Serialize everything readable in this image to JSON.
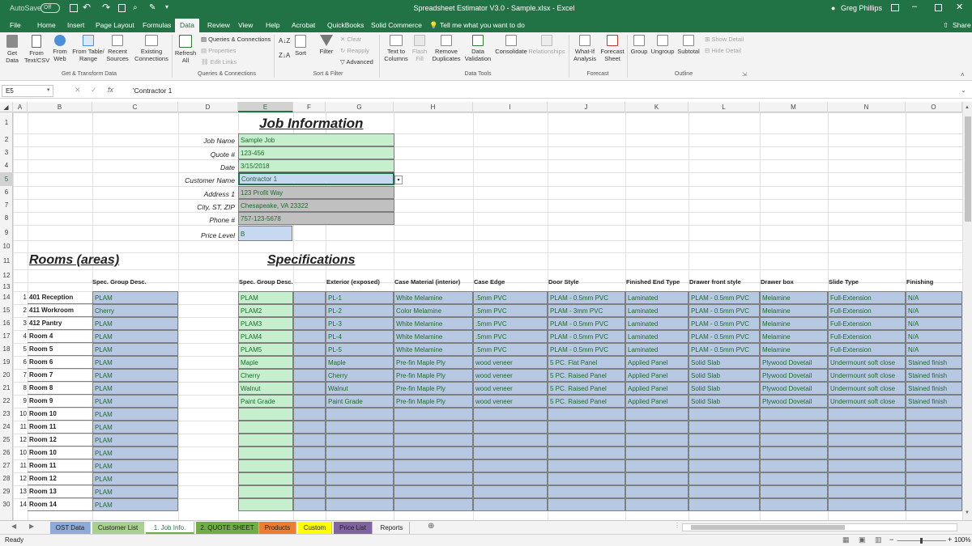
{
  "titlebar": {
    "autosave_label": "AutoSave",
    "autosave_state": "Off",
    "title": "Spreadsheet Estimator V3.0 - Sample.xlsx  -  Excel",
    "user": "Greg Phillips"
  },
  "menu": {
    "tabs": [
      "File",
      "Home",
      "Insert",
      "Page Layout",
      "Formulas",
      "Data",
      "Review",
      "View",
      "Help",
      "Acrobat",
      "QuickBooks",
      "Solid Commerce"
    ],
    "active": "Data",
    "tell_me": "Tell me what you want to do",
    "share": "Share"
  },
  "ribbon": {
    "get_data": "Get\nData",
    "from_text": "From\nText/CSV",
    "from_web": "From\nWeb",
    "from_table": "From Table/\nRange",
    "recent_sources": "Recent\nSources",
    "existing_connections": "Existing\nConnections",
    "group1": "Get & Transform Data",
    "refresh_all": "Refresh\nAll",
    "queries_connections": "Queries & Connections",
    "properties": "Properties",
    "edit_links": "Edit Links",
    "group2": "Queries & Connections",
    "sort": "Sort",
    "filter": "Filter",
    "clear": "Clear",
    "reapply": "Reapply",
    "advanced": "Advanced",
    "group3": "Sort & Filter",
    "text_to_columns": "Text to\nColumns",
    "flash_fill": "Flash\nFill",
    "remove_duplicates": "Remove\nDuplicates",
    "data_validation": "Data\nValidation",
    "consolidate": "Consolidate",
    "relationships": "Relationships",
    "group4": "Data Tools",
    "what_if": "What-If\nAnalysis",
    "forecast_sheet": "Forecast\nSheet",
    "group5": "Forecast",
    "group_btn": "Group",
    "ungroup": "Ungroup",
    "subtotal": "Subtotal",
    "show_detail": "Show Detail",
    "hide_detail": "Hide Detail",
    "group6": "Outline"
  },
  "formula_bar": {
    "name_box": "E5",
    "fx": "fx",
    "content": "'Contractor 1"
  },
  "columns": [
    "A",
    "B",
    "C",
    "D",
    "E",
    "F",
    "G",
    "H",
    "I",
    "J",
    "K",
    "L",
    "M",
    "N",
    "O"
  ],
  "rows": [
    "1",
    "2",
    "3",
    "4",
    "5",
    "6",
    "7",
    "8",
    "9",
    "10",
    "11",
    "12",
    "13",
    "14",
    "15",
    "16",
    "17",
    "18",
    "19",
    "20",
    "21",
    "22",
    "23",
    "24",
    "25",
    "26",
    "27",
    "28",
    "29",
    "30"
  ],
  "job_info": {
    "title": "Job Information",
    "labels": [
      "Job Name",
      "Quote #",
      "Date",
      "Customer Name",
      "Address 1",
      "City, ST, ZIP",
      "Phone #",
      "Price Level"
    ],
    "values": [
      "Sample Job",
      "123-456",
      "3/15/2018",
      "Contractor 1",
      "123 Profit Way",
      "Chesapeake, VA 23322",
      "757-123-5678",
      "B"
    ]
  },
  "rooms": {
    "title": "Rooms (areas)",
    "header": "Spec. Group Desc.",
    "list": [
      {
        "n": "1",
        "name": "401 Reception",
        "spec": "PLAM"
      },
      {
        "n": "2",
        "name": "411 Workroom",
        "spec": "Cherry"
      },
      {
        "n": "3",
        "name": "412 Pantry",
        "spec": "PLAM"
      },
      {
        "n": "4",
        "name": "Room 4",
        "spec": "PLAM"
      },
      {
        "n": "5",
        "name": "Room 5",
        "spec": "PLAM"
      },
      {
        "n": "6",
        "name": "Room 6",
        "spec": "PLAM"
      },
      {
        "n": "7",
        "name": "Room 7",
        "spec": "PLAM"
      },
      {
        "n": "8",
        "name": "Room 8",
        "spec": "PLAM"
      },
      {
        "n": "9",
        "name": "Room 9",
        "spec": "PLAM"
      },
      {
        "n": "10",
        "name": "Room 10",
        "spec": "PLAM"
      },
      {
        "n": "11",
        "name": "Room 11",
        "spec": "PLAM"
      },
      {
        "n": "12",
        "name": "Room 12",
        "spec": "PLAM"
      },
      {
        "n": "10",
        "name": "Room 10",
        "spec": "PLAM"
      },
      {
        "n": "11",
        "name": "Room 11",
        "spec": "PLAM"
      },
      {
        "n": "12",
        "name": "Room 12",
        "spec": "PLAM"
      },
      {
        "n": "13",
        "name": "Room 13",
        "spec": "PLAM"
      },
      {
        "n": "14",
        "name": "Room 14",
        "spec": "PLAM"
      }
    ]
  },
  "specs": {
    "title": "Specifications",
    "headers": [
      "Spec. Group Desc.",
      "Exterior (exposed)",
      "Case Material (interior)",
      "Case Edge",
      "Door Style",
      "Finished End Type",
      "Drawer front style",
      "Drawer box",
      "Slide Type",
      "Finishing"
    ],
    "rows": [
      [
        "PLAM",
        "PL-1",
        "White Melamine",
        ".5mm PVC",
        "PLAM - 0.5mm PVC",
        "Laminated",
        "PLAM - 0.5mm PVC",
        "Melamine",
        "Full-Extension",
        "N/A"
      ],
      [
        "PLAM2",
        "PL-2",
        "Color Melamine",
        ".5mm PVC",
        "PLAM - 3mm PVC",
        "Laminated",
        "PLAM - 0.5mm PVC",
        "Melamine",
        "Full-Extension",
        "N/A"
      ],
      [
        "PLAM3",
        "PL-3",
        "White Melamine",
        ".5mm PVC",
        "PLAM - 0.5mm PVC",
        "Laminated",
        "PLAM - 0.5mm PVC",
        "Melamine",
        "Full-Extension",
        "N/A"
      ],
      [
        "PLAM4",
        "PL-4",
        "White Melamine",
        ".5mm PVC",
        "PLAM - 0.5mm PVC",
        "Laminated",
        "PLAM - 0.5mm PVC",
        "Melamine",
        "Full-Extension",
        "N/A"
      ],
      [
        "PLAM5",
        "PL-5",
        "White Melamine",
        ".5mm PVC",
        "PLAM - 0.5mm PVC",
        "Laminated",
        "PLAM - 0.5mm PVC",
        "Melamine",
        "Full-Extension",
        "N/A"
      ],
      [
        "Maple",
        "Maple",
        "Pre-fin Maple Ply",
        "wood veneer",
        "5 PC. Flat Panel",
        "Applied Panel",
        "Solid Slab",
        "Plywood Dovetail",
        "Undermount soft close",
        "Stained finish"
      ],
      [
        "Cherry",
        "Cherry",
        "Pre-fin Maple Ply",
        "wood veneer",
        "5 PC. Raised Panel",
        "Applied Panel",
        "Solid Slab",
        "Plywood Dovetail",
        "Undermount soft close",
        "Stained finish"
      ],
      [
        "Walnut",
        "Walnut",
        "Pre-fin Maple Ply",
        "wood veneer",
        "5 PC. Raised Panel",
        "Applied Panel",
        "Solid Slab",
        "Plywood Dovetail",
        "Undermount soft close",
        "Stained finish"
      ],
      [
        "Paint Grade",
        "Paint Grade",
        "Pre-fin Maple Ply",
        "wood veneer",
        "5 PC. Raised Panel",
        "Applied Panel",
        "Solid Slab",
        "Plywood Dovetail",
        "Undermount soft close",
        "Stained finish"
      ]
    ]
  },
  "sheet_tabs": [
    {
      "label": "OST Data",
      "color": "#8eaadb"
    },
    {
      "label": "Customer List",
      "color": "#a9d08e"
    },
    {
      "label": "1. Job Info.",
      "color": "#ffffff",
      "active": true
    },
    {
      "label": "2. QUOTE SHEET",
      "color": "#70ad47"
    },
    {
      "label": "Products",
      "color": "#ed7d31"
    },
    {
      "label": "Custom",
      "color": "#ffff00"
    },
    {
      "label": "Price List",
      "color": "#8064a2"
    },
    {
      "label": "Reports",
      "color": "#f3f3f3"
    }
  ],
  "status": {
    "ready": "Ready",
    "zoom": "100%"
  }
}
